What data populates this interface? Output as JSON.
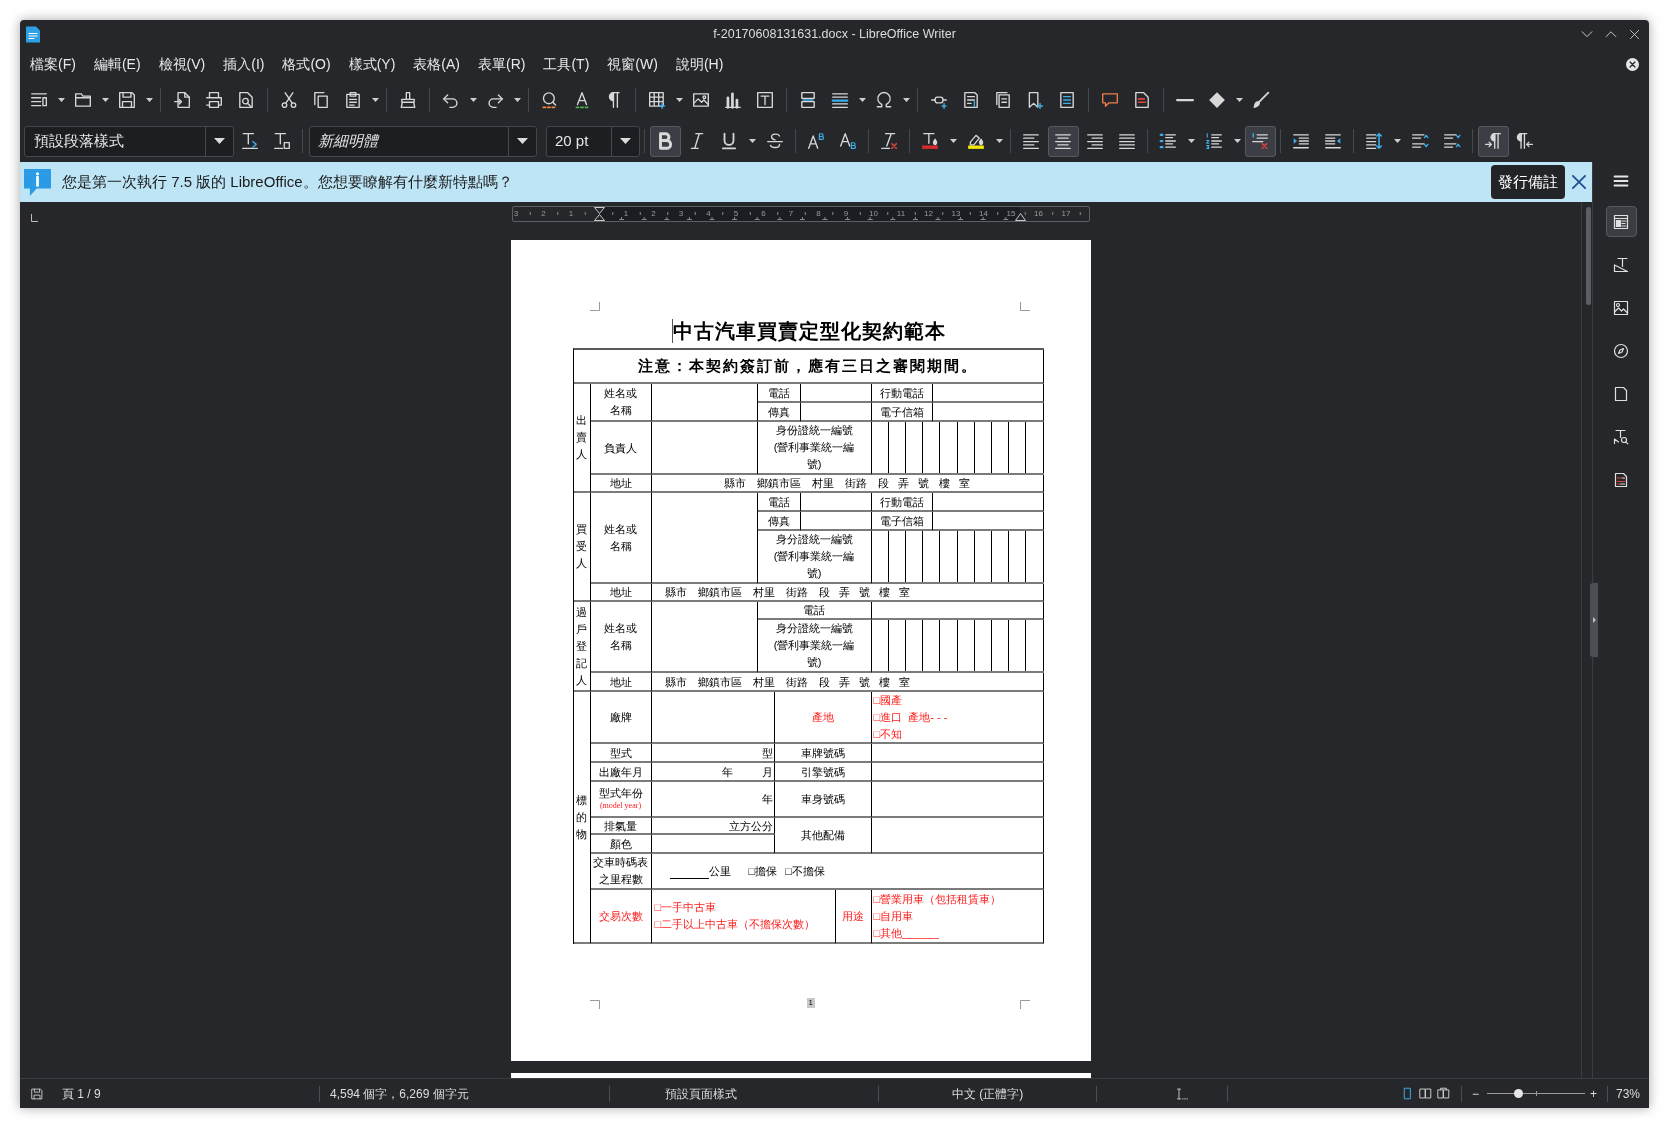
{
  "window": {
    "title": "f-20170608131631.docx - LibreOffice Writer"
  },
  "menu": [
    "檔案(F)",
    "編輯(E)",
    "檢視(V)",
    "插入(I)",
    "格式(O)",
    "樣式(Y)",
    "表格(A)",
    "表單(R)",
    "工具(T)",
    "視窗(W)",
    "說明(H)"
  ],
  "formatting": {
    "paragraph_style": "預設段落樣式",
    "font_name": "新細明體",
    "font_substituted": true,
    "font_size": "20 pt",
    "bold": true,
    "italic": false,
    "underline": false,
    "strikethrough": false,
    "superscript": false,
    "subscript": false,
    "align_left": false,
    "align_center": true,
    "align_right": false,
    "justify": false,
    "bullets": false,
    "numbering": false,
    "no_list": true,
    "left_to_right": true,
    "right_to_left": false
  },
  "infobar": {
    "message": "您是第一次執行 7.5 版的 LibreOffice。您想要瞭解有什麼新特點嗎？",
    "button": "發行備註"
  },
  "sidebar_tabs": [
    {
      "selected": true
    },
    {
      "selected": false
    },
    {
      "selected": false
    },
    {
      "selected": false
    },
    {
      "selected": false
    },
    {
      "selected": false
    },
    {
      "selected": false
    }
  ],
  "ruler": {
    "left_labels": [
      "3",
      "2",
      "1"
    ],
    "right_labels": [
      "1",
      "2",
      "3",
      "4",
      "5",
      "6",
      "7",
      "8",
      "9",
      "10",
      "11",
      "12",
      "13",
      "14",
      "15",
      "16",
      "17"
    ]
  },
  "document": {
    "title": "中古汽車買賣定型化契約範本",
    "table": {
      "notice": "注意：本契約簽訂前，應有三日之審閱期間。",
      "seller": {
        "label": "出賣人",
        "name_label": "姓名或名稱",
        "phone_label": "電話",
        "mobile_label": "行動電話",
        "fax_label": "傳真",
        "email_label": "電子信箱",
        "representative_label": "負責人",
        "id_label": "身份證統一編號(營利事業統一編號)",
        "address_label": "地址",
        "address": "縣市　鄉鎮市區　村里　街路　段   弄   號   樓   室"
      },
      "buyer": {
        "label": "買受人",
        "name_label": "姓名或名稱",
        "phone_label": "電話",
        "mobile_label": "行動電話",
        "fax_label": "傳真",
        "email_label": "電子信箱",
        "id_label": "身分證統一編號(營利事業統一編號)",
        "address_label": "地址",
        "address": "縣市　鄉鎮市區　村里　街路　段   弄   號   樓   室"
      },
      "registrant": {
        "label": "過戶登記人",
        "name_label": "姓名或名稱",
        "phone_label": "電話",
        "id_label": "身分證統一編號(營利事業統一編號)",
        "address_label": "地址",
        "address": "縣市　鄉鎮市區　村里　街路　段   弄   號   樓   室"
      },
      "vehicle": {
        "label": "標的物",
        "brand_label": "廠牌",
        "origin_label": "產地",
        "origin_options": [
          "□國產",
          "□進口  產地- - -",
          "□不知"
        ],
        "model_label": "型式",
        "model_unit": "型",
        "plate_label": "車牌號碼",
        "manufacture_label": "出廠年月",
        "year_unit": "年",
        "month_unit": "月",
        "engine_label": "引擎號碼",
        "model_year_label": "型式年份",
        "model_year_note": "(model year)",
        "model_year_unit": "年",
        "body_label": "車身號碼",
        "displacement_label": "排氣量",
        "displacement_unit": "立方公分",
        "accessories_label": "其他配備",
        "color_label": "顏色",
        "mileage_label": "交車時碼表之里程數",
        "mileage_unit": "公里",
        "warranty_options": [
          "□擔保",
          "□不擔保"
        ],
        "transactions_label": "交易次數",
        "transaction_options": [
          "□一手中古車",
          "□二手以上中古車（不擔保次數）"
        ],
        "usage_label": "用途",
        "usage_options": [
          "□營業用車（包括租賃車）",
          "□自用車",
          "□其他______"
        ]
      }
    },
    "page_number": "1"
  },
  "status_bar": {
    "page": "頁 1 / 9",
    "words": "4,594 個字，6,269 個字元",
    "page_style": "預設頁面樣式",
    "language": "中文 (正體字)",
    "view_layouts": [
      {
        "selected": true
      },
      {
        "selected": false
      },
      {
        "selected": false
      }
    ],
    "zoom_out": "−",
    "zoom": {
      "level": 0.32
    },
    "zoom_in": "+",
    "zoom_percent": "73%"
  }
}
